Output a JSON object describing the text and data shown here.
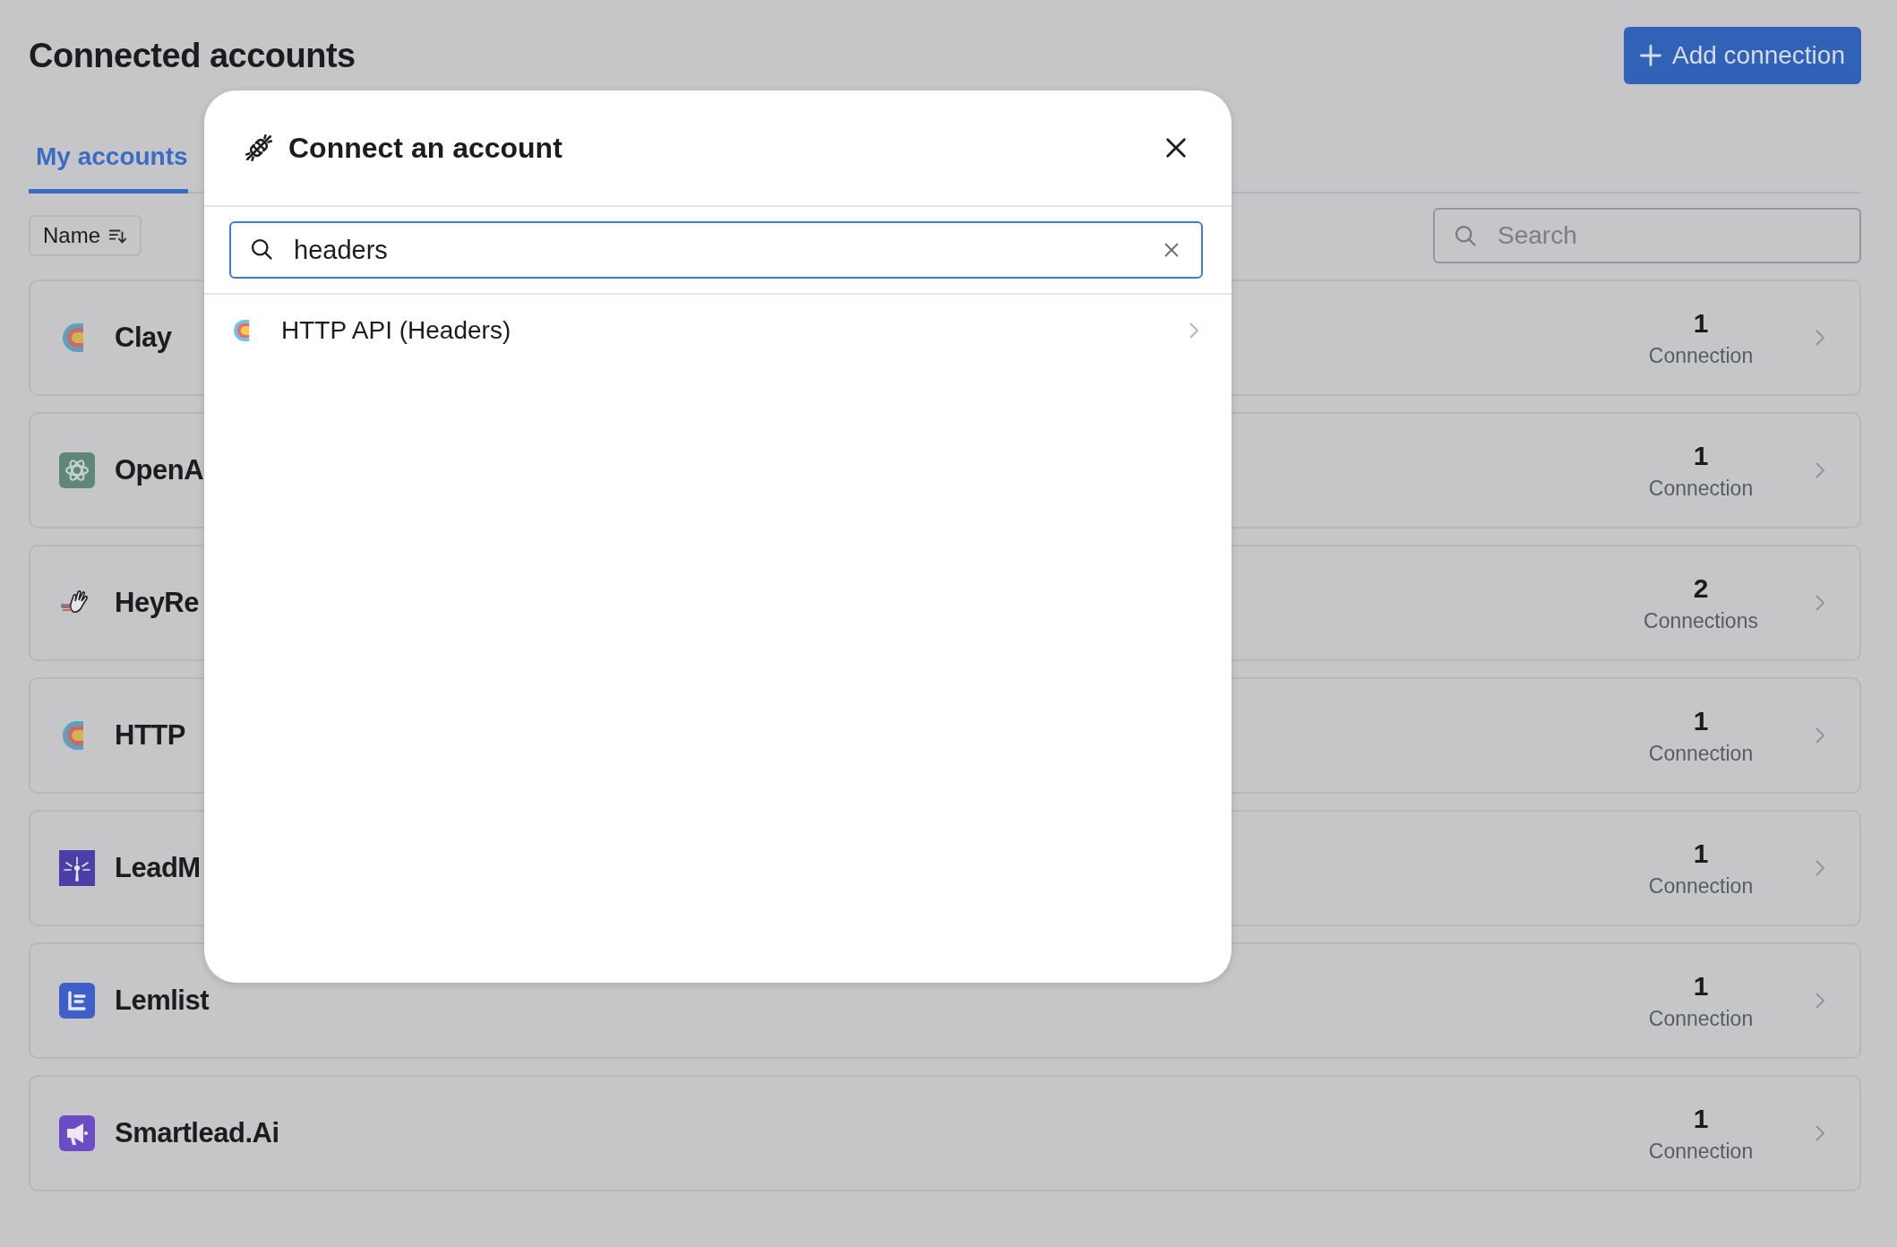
{
  "page": {
    "title": "Connected accounts",
    "add_button": "Add connection"
  },
  "tabs": [
    {
      "label": "My accounts",
      "selected": true
    }
  ],
  "sort_button": "Name",
  "search": {
    "placeholder": "Search"
  },
  "accounts": [
    {
      "name": "Clay",
      "kind": "clay",
      "count": "1",
      "unit": "Connection"
    },
    {
      "name": "OpenA",
      "kind": "openai",
      "count": "1",
      "unit": "Connection"
    },
    {
      "name": "HeyRe",
      "kind": "hand",
      "count": "2",
      "unit": "Connections"
    },
    {
      "name": "HTTP",
      "kind": "clay",
      "count": "1",
      "unit": "Connection"
    },
    {
      "name": "LeadM",
      "kind": "spark",
      "count": "1",
      "unit": "Connection"
    },
    {
      "name": "Lemlist",
      "kind": "lemlist",
      "count": "1",
      "unit": "Connection"
    },
    {
      "name": "Smartlead.Ai",
      "kind": "megaphone",
      "count": "1",
      "unit": "Connection"
    }
  ],
  "modal": {
    "title": "Connect an account",
    "search_value": "headers",
    "results": [
      {
        "name": "HTTP API (Headers)",
        "kind": "clay"
      }
    ]
  }
}
